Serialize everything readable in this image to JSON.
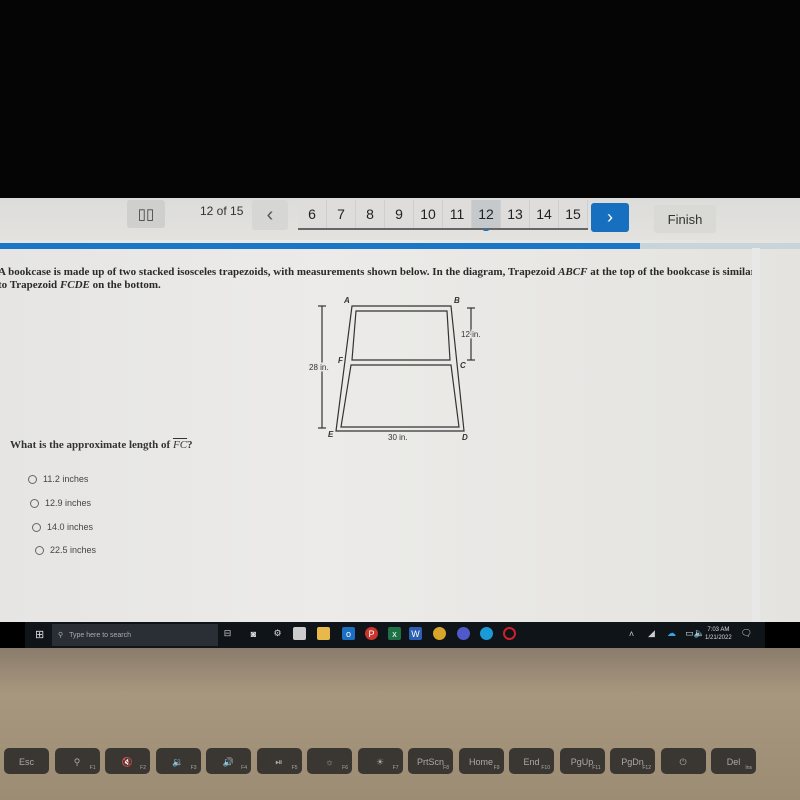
{
  "toolbar": {
    "pause_icon": "pause-icon",
    "question_counter": "12 of 15",
    "prev_icon": "‹",
    "pages": [
      "6",
      "7",
      "8",
      "9",
      "10",
      "11",
      "12",
      "13",
      "14",
      "15"
    ],
    "current_page": "12",
    "next_icon": "›",
    "finish_label": "Finish",
    "progress_fraction": 0.8
  },
  "content": {
    "prompt_line1_a": "A bookcase is made up of two stacked isosceles trapezoids, with measurements shown below. In the diagram, Trapezoid ",
    "prompt_line1_em": "ABCF",
    "prompt_line1_b": " at the top of the bookcase is similar",
    "prompt_line2_a": "to Trapezoid ",
    "prompt_line2_em": "FCDE",
    "prompt_line2_b": " on the bottom.",
    "diagram": {
      "labels": {
        "A": "A",
        "B": "B",
        "C": "C",
        "D": "D",
        "E": "E",
        "F": "F"
      },
      "height_total": "28 in.",
      "height_top": "12 in.",
      "base_bottom": "30 in."
    },
    "question_a": "What is the approximate length of ",
    "question_segment": "FC",
    "question_b": "?",
    "choices": [
      "11.2 inches",
      "12.9 inches",
      "14.0 inches",
      "22.5 inches"
    ]
  },
  "taskbar": {
    "search_placeholder": "Type here to search",
    "time": "7:03 AM",
    "date": "1/21/2022"
  },
  "keyboard": {
    "keys": [
      {
        "main": "Esc",
        "fn": ""
      },
      {
        "main": "⚲",
        "fn": "F1"
      },
      {
        "main": "🔇",
        "fn": "F2"
      },
      {
        "main": "🔉",
        "fn": "F3"
      },
      {
        "main": "🔊",
        "fn": "F4"
      },
      {
        "main": "⏯",
        "fn": "F5"
      },
      {
        "main": "☼",
        "fn": "F6"
      },
      {
        "main": "☀",
        "fn": "F7"
      },
      {
        "main": "PrtScn",
        "fn": "F8"
      },
      {
        "main": "Home",
        "fn": "F9"
      },
      {
        "main": "End",
        "fn": "F10"
      },
      {
        "main": "PgUp",
        "fn": "F11"
      },
      {
        "main": "PgDn",
        "fn": "F12"
      },
      {
        "main": "⏻",
        "fn": ""
      },
      {
        "main": "Del",
        "fn": "Ins"
      }
    ]
  }
}
